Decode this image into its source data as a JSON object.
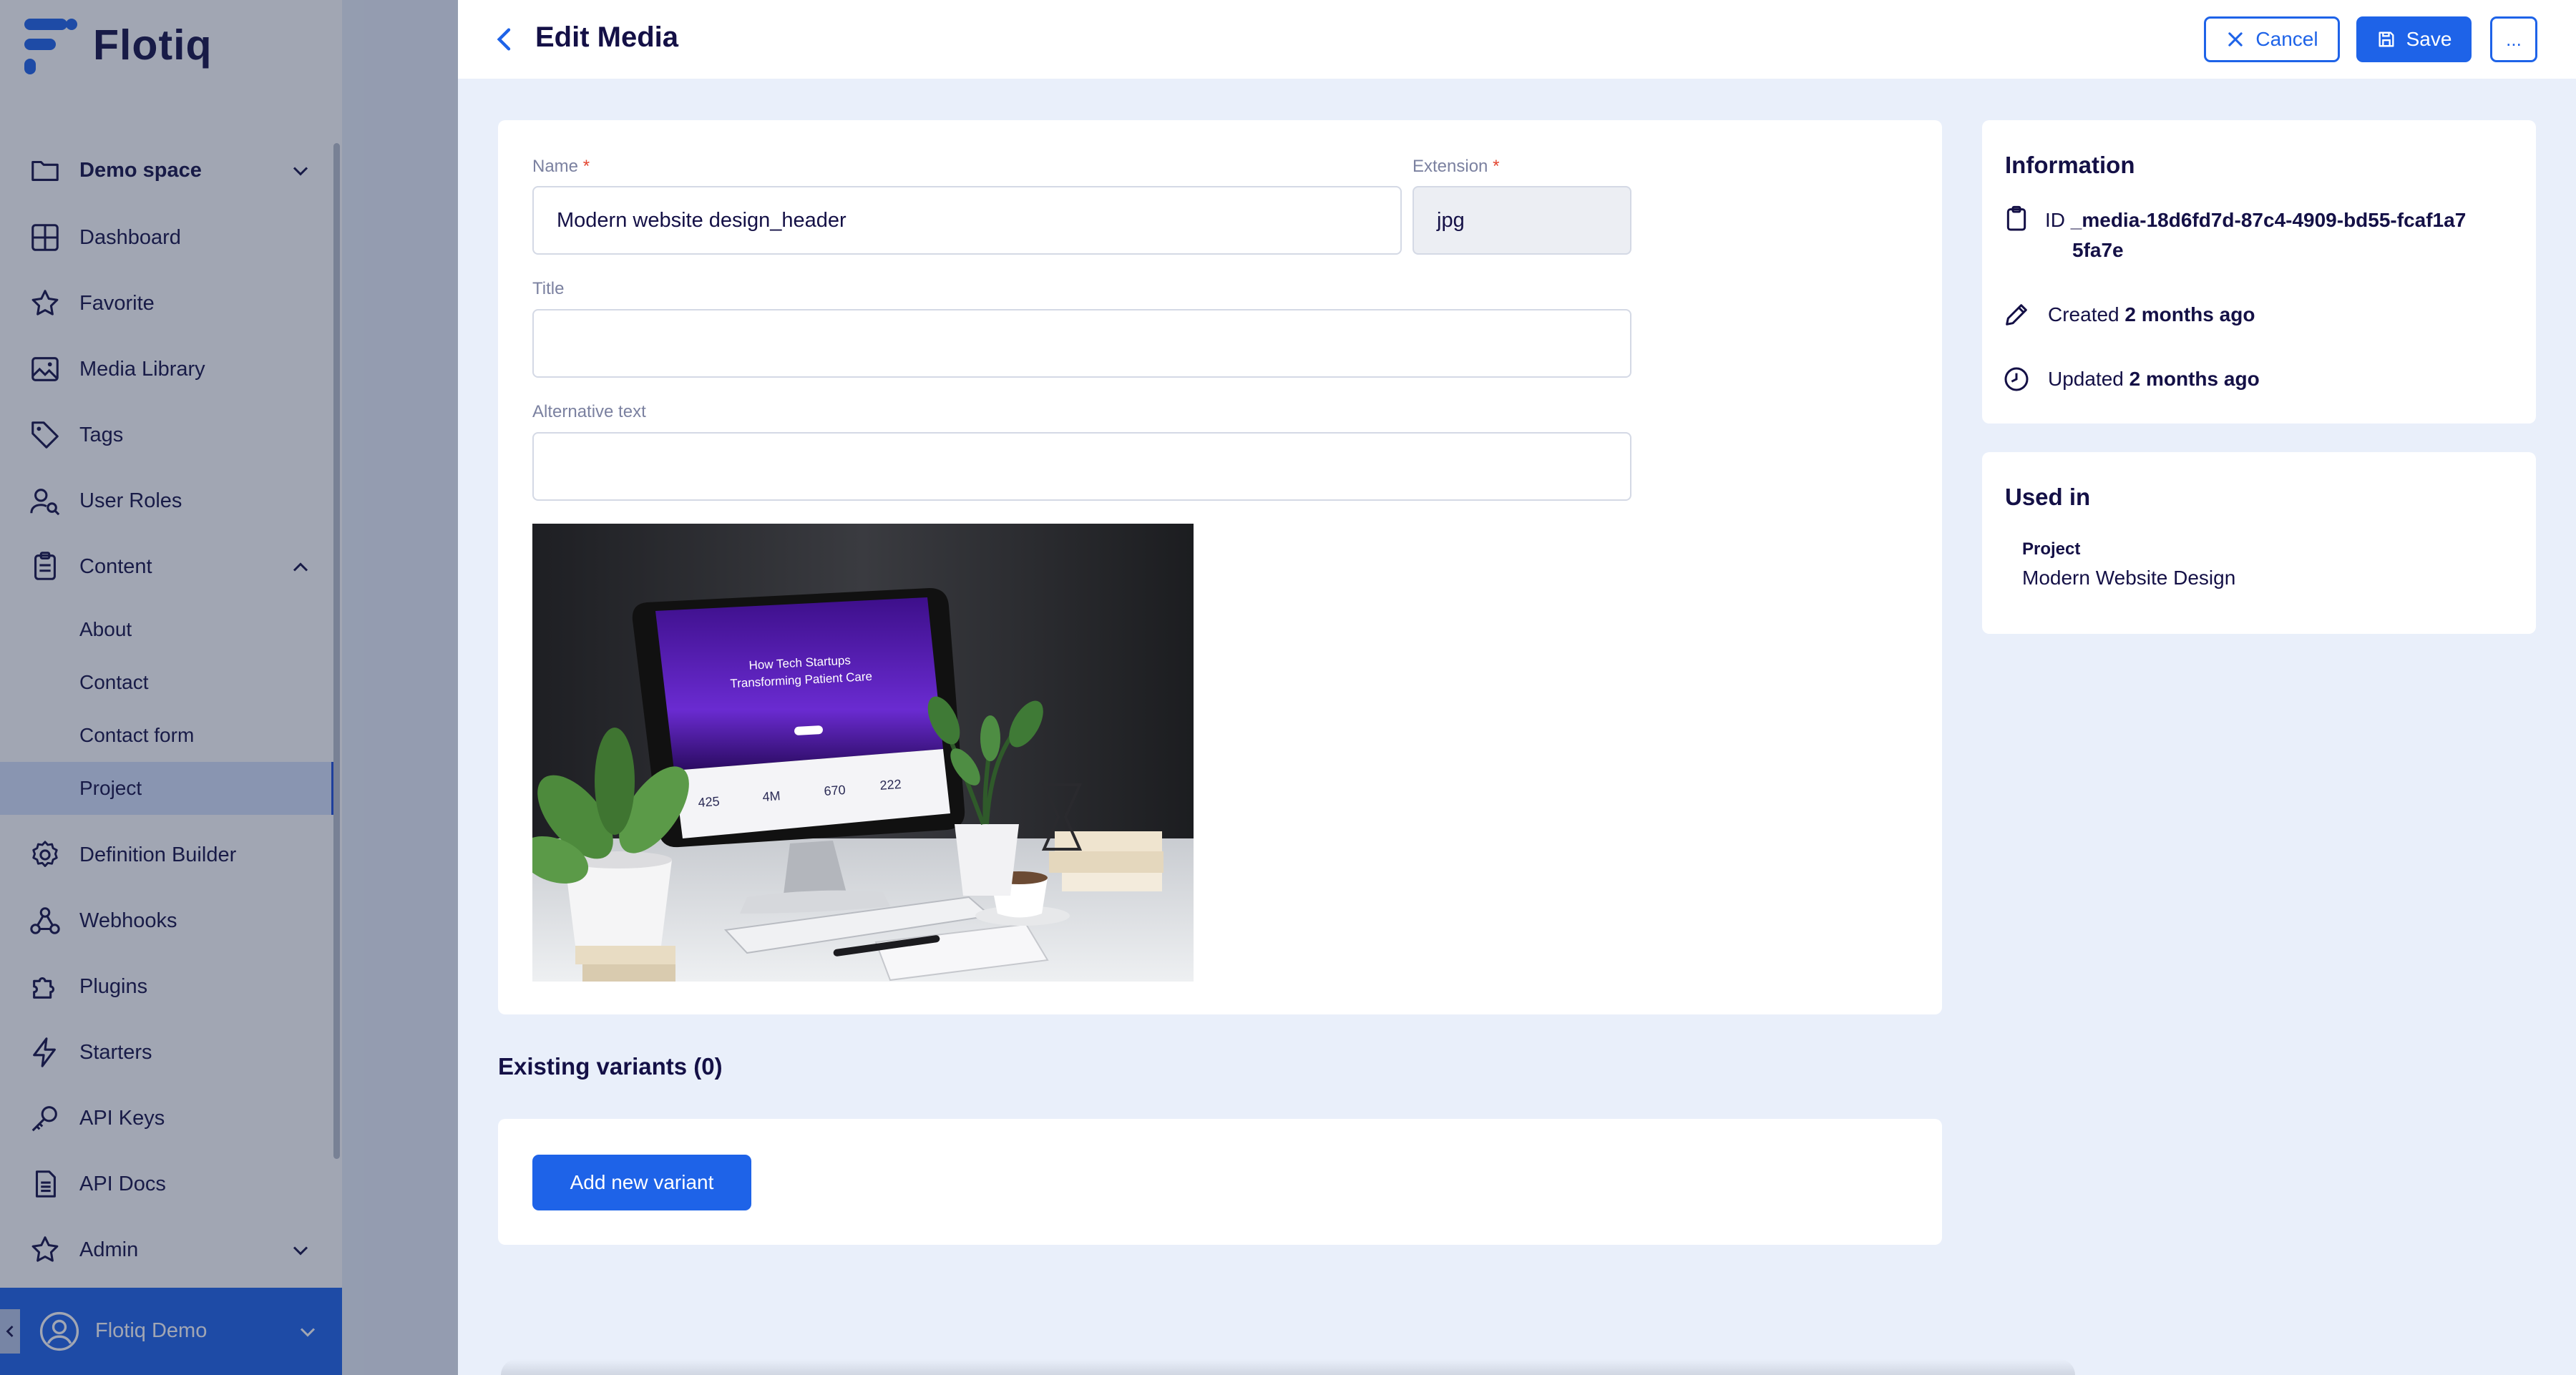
{
  "brand": {
    "name": "Flotiq",
    "color": "#1e63e8",
    "dark": "#141046"
  },
  "sidebar": {
    "items": [
      {
        "label": "Demo space",
        "icon": "folder-icon"
      },
      {
        "label": "Dashboard",
        "icon": "dashboard-icon"
      },
      {
        "label": "Favorite",
        "icon": "star-icon"
      },
      {
        "label": "Media Library",
        "icon": "image-icon"
      },
      {
        "label": "Tags",
        "icon": "tag-icon"
      },
      {
        "label": "User Roles",
        "icon": "user-roles-icon"
      },
      {
        "label": "Content",
        "icon": "clipboard-icon"
      },
      {
        "label": "Definition Builder",
        "icon": "gear-icon"
      },
      {
        "label": "Webhooks",
        "icon": "webhook-icon"
      },
      {
        "label": "Plugins",
        "icon": "puzzle-icon"
      },
      {
        "label": "Starters",
        "icon": "lightning-icon"
      },
      {
        "label": "API Keys",
        "icon": "key-icon"
      },
      {
        "label": "API Docs",
        "icon": "document-icon"
      },
      {
        "label": "Admin",
        "icon": "star-icon"
      }
    ],
    "content_items": [
      "About",
      "Contact",
      "Contact form",
      "Project"
    ],
    "active_content_item": "Project",
    "user": {
      "name": "Flotiq Demo"
    }
  },
  "header": {
    "title": "Edit Media",
    "cancel_label": "Cancel",
    "save_label": "Save",
    "more_label": "..."
  },
  "form": {
    "name_label": "Name",
    "name_value": "Modern website design_header",
    "extension_label": "Extension",
    "extension_value": "jpg",
    "required_mark": "*",
    "title_label": "Title",
    "title_value": "",
    "alt_label": "Alternative text",
    "alt_value": ""
  },
  "preview_image": {
    "headline_line1": "How Tech Startups",
    "headline_line2": "Transforming Patient Care",
    "stats": [
      "425",
      "4M",
      "670",
      "222"
    ]
  },
  "variants": {
    "title": "Existing variants (0)",
    "add_label": "Add new variant"
  },
  "information": {
    "title": "Information",
    "id_label": "ID",
    "id_line1": "_media-18d6fd7d-87c4-4909-bd55-fcaf1a7",
    "id_line2": "5fa7e",
    "created_label": "Created",
    "created_value": "2 months ago",
    "updated_label": "Updated",
    "updated_value": "2 months ago"
  },
  "used_in": {
    "title": "Used in",
    "type": "Project",
    "name": "Modern Website Design"
  }
}
